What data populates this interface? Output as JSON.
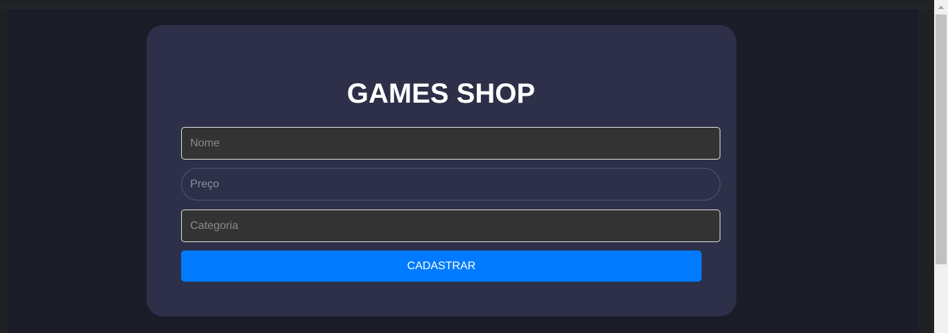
{
  "page": {
    "title": "GAMES SHOP"
  },
  "form": {
    "nome": {
      "placeholder": "Nome",
      "value": ""
    },
    "preco": {
      "placeholder": "Preço",
      "value": ""
    },
    "categoria": {
      "placeholder": "Categoria",
      "value": ""
    },
    "submit_label": "CADASTRAR"
  },
  "colors": {
    "page_background": "#1b1c28",
    "card_background": "#2e3049",
    "input_background": "#333333",
    "button_accent": "#007bff"
  }
}
